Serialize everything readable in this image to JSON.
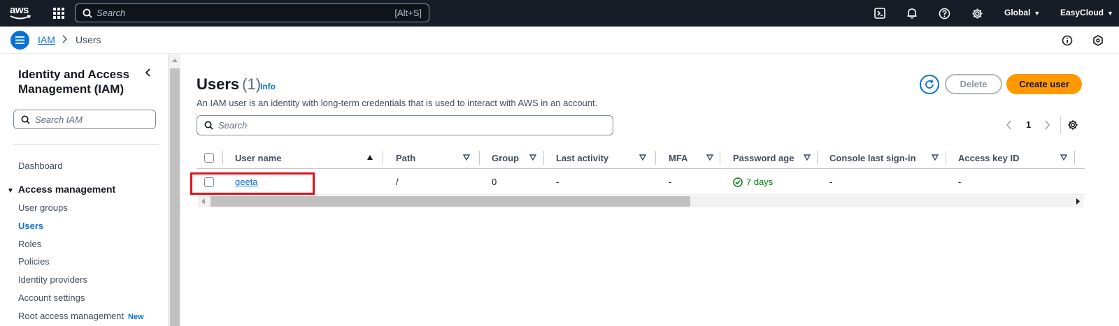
{
  "topnav": {
    "logo_text": "aws",
    "search_placeholder": "Search",
    "search_shortcut": "[Alt+S]",
    "region": "Global",
    "account": "EasyCloud",
    "icons": [
      "services-grid-icon",
      "cloudshell-icon",
      "bell-icon",
      "help-icon",
      "gear-icon"
    ]
  },
  "breadcrumb": {
    "root": "IAM",
    "current": "Users"
  },
  "sidebar": {
    "title": "Identity and Access Management (IAM)",
    "search_placeholder": "Search IAM",
    "dashboard": "Dashboard",
    "section": "Access management",
    "items": [
      {
        "label": "User groups"
      },
      {
        "label": "Users",
        "active": true
      },
      {
        "label": "Roles"
      },
      {
        "label": "Policies"
      },
      {
        "label": "Identity providers"
      },
      {
        "label": "Account settings"
      },
      {
        "label": "Root access management",
        "badge": "New"
      }
    ]
  },
  "main": {
    "title": "Users",
    "count": "(1)",
    "info": "Info",
    "description": "An IAM user is an identity with long-term credentials that is used to interact with AWS in an account.",
    "delete_label": "Delete",
    "create_label": "Create user",
    "search_placeholder": "Search",
    "page": "1",
    "columns": [
      "User name",
      "Path",
      "Groups",
      "Last activity",
      "MFA",
      "Password age",
      "Console last sign-in",
      "Access key ID"
    ],
    "rows": [
      {
        "user_name": "geeta",
        "path": "/",
        "groups": "0",
        "last_activity": "-",
        "mfa": "-",
        "password_age": "7 days",
        "console_last_sign_in": "-",
        "access_key_id": "-"
      }
    ]
  },
  "colors": {
    "nav_bg": "#161d26",
    "link": "#0972d3",
    "primary_button": "#ff9900",
    "success": "#037f0c",
    "highlight": "#e0121a"
  }
}
